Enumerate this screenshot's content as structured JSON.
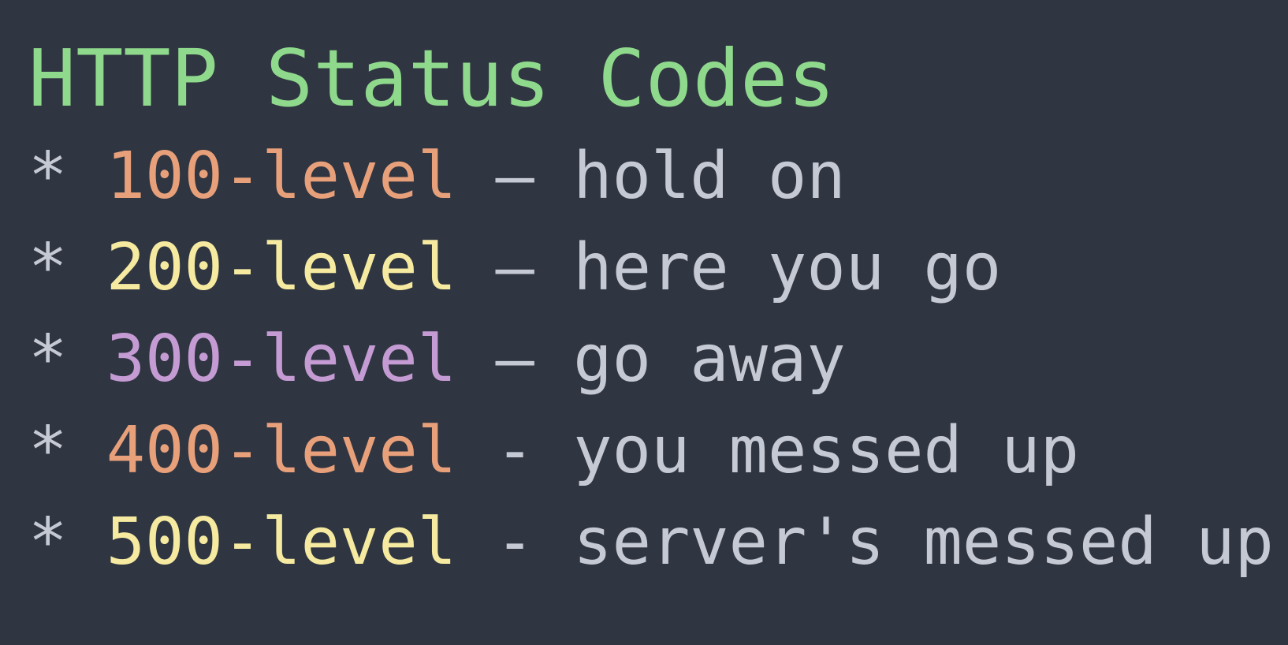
{
  "title": "HTTP Status Codes",
  "colors": {
    "background": "#2f3541",
    "heading": "#8fd98c",
    "text": "#c5c9d3",
    "orange": "#e8a07a",
    "yellow": "#f5eaa0",
    "purple": "#c59bd4"
  },
  "items": [
    {
      "bullet": "*",
      "code": "100-level",
      "sep": "–",
      "desc": "hold on"
    },
    {
      "bullet": "*",
      "code": "200-level",
      "sep": "–",
      "desc": "here you go"
    },
    {
      "bullet": "*",
      "code": "300-level",
      "sep": "–",
      "desc": "go away"
    },
    {
      "bullet": "*",
      "code": "400-level",
      "sep": "-",
      "desc": "you messed up"
    },
    {
      "bullet": "*",
      "code": "500-level",
      "sep": "-",
      "desc": "server's messed up"
    }
  ]
}
